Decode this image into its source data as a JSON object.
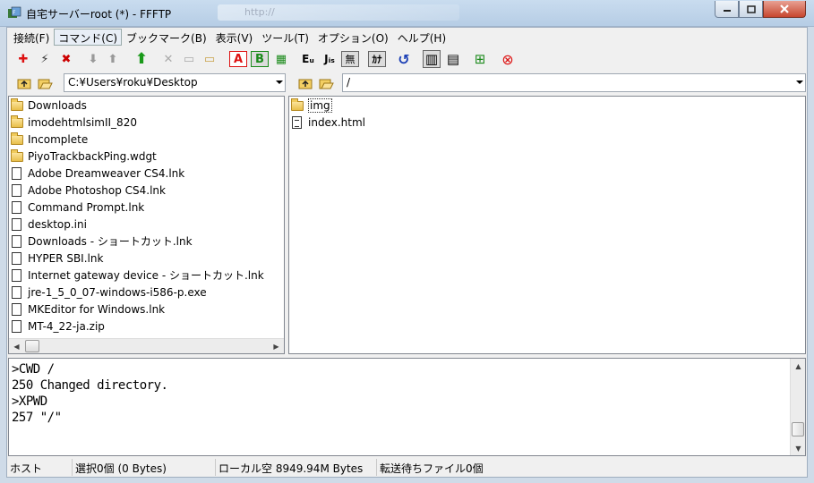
{
  "window": {
    "title": "自宅サーバーroot (*) - FFFTP",
    "address_blur": "http://"
  },
  "menu": [
    {
      "label": "接続(F)"
    },
    {
      "label": "コマンド(C)"
    },
    {
      "label": "ブックマーク(B)"
    },
    {
      "label": "表示(V)"
    },
    {
      "label": "ツール(T)"
    },
    {
      "label": "オプション(O)"
    },
    {
      "label": "ヘルプ(H)"
    }
  ],
  "toolbar": {
    "colors": {
      "connect": "#d11",
      "quick": "#333",
      "disconnect": "#c00",
      "download": "#999",
      "upload_arrow": "#1a9a1a",
      "stop": "#d11",
      "refresh": "#1b3fb5"
    },
    "glyphs": {
      "connect": "✚",
      "quick_connect": "⚡",
      "disconnect": "✖",
      "download": "⬇",
      "upload": "⬆",
      "mirror_upload": "⬆",
      "delete": "✕",
      "rename": "▭",
      "mkdir": "▭",
      "ascii_mode": "A",
      "binary_mode": "B",
      "auto_mode": "▦",
      "euc_kanji": "Eᵤ",
      "jis_kanji": "Jᵢₛ",
      "no_conversion": "無",
      "kana_conversion": "ｶﾅ",
      "refresh": "↺",
      "list_view": "▥",
      "detail_view": "▤",
      "tree_sync": "⊞",
      "stop": "⊗"
    }
  },
  "local": {
    "path": "C:¥Users¥roku¥Desktop",
    "files": [
      {
        "name": "Downloads",
        "type": "folder"
      },
      {
        "name": "imodehtmlsimII_820",
        "type": "folder"
      },
      {
        "name": "Incomplete",
        "type": "folder"
      },
      {
        "name": "PiyoTrackbackPing.wdgt",
        "type": "folder"
      },
      {
        "name": "Adobe Dreamweaver CS4.lnk",
        "type": "file"
      },
      {
        "name": "Adobe Photoshop CS4.lnk",
        "type": "file"
      },
      {
        "name": "Command Prompt.lnk",
        "type": "file"
      },
      {
        "name": "desktop.ini",
        "type": "file"
      },
      {
        "name": "Downloads - ショートカット.lnk",
        "type": "file"
      },
      {
        "name": "HYPER SBI.lnk",
        "type": "file"
      },
      {
        "name": "Internet gateway device - ショートカット.lnk",
        "type": "file"
      },
      {
        "name": "jre-1_5_0_07-windows-i586-p.exe",
        "type": "file"
      },
      {
        "name": "MKEditor for Windows.lnk",
        "type": "file"
      },
      {
        "name": "MT-4_22-ja.zip",
        "type": "file"
      }
    ]
  },
  "remote": {
    "path": "/",
    "files": [
      {
        "name": "img",
        "type": "folder"
      },
      {
        "name": "index.html",
        "type": "file"
      }
    ]
  },
  "log": {
    "lines": [
      ">CWD /",
      "250 Changed directory.",
      ">XPWD",
      "257 \"/\""
    ]
  },
  "status": {
    "host": "ホスト",
    "selection": "選択0個 (0 Bytes)",
    "local_free": "ローカル空 8949.94M Bytes",
    "queue": "転送待ちファイル0個"
  }
}
